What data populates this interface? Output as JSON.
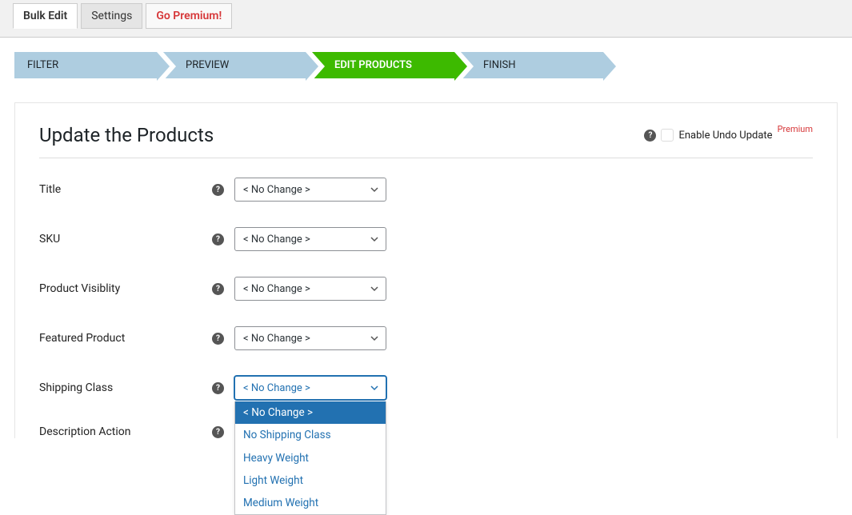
{
  "topTabs": {
    "bulkEdit": "Bulk Edit",
    "settings": "Settings",
    "goPremium": "Go Premium!"
  },
  "steps": {
    "filter": "FILTER",
    "preview": "PREVIEW",
    "edit": "EDIT PRODUCTS",
    "finish": "FINISH"
  },
  "panel": {
    "title": "Update the Products",
    "undoLabel": "Enable Undo Update",
    "premiumBadge": "Premium"
  },
  "noChange": "< No Change >",
  "fields": {
    "title": "Title",
    "sku": "SKU",
    "visibility": "Product Visiblity",
    "featured": "Featured Product",
    "shipping": "Shipping Class",
    "description": "Description Action"
  },
  "shippingOptions": [
    "< No Change >",
    "No Shipping Class",
    "Heavy Weight",
    "Light Weight",
    "Medium Weight"
  ]
}
